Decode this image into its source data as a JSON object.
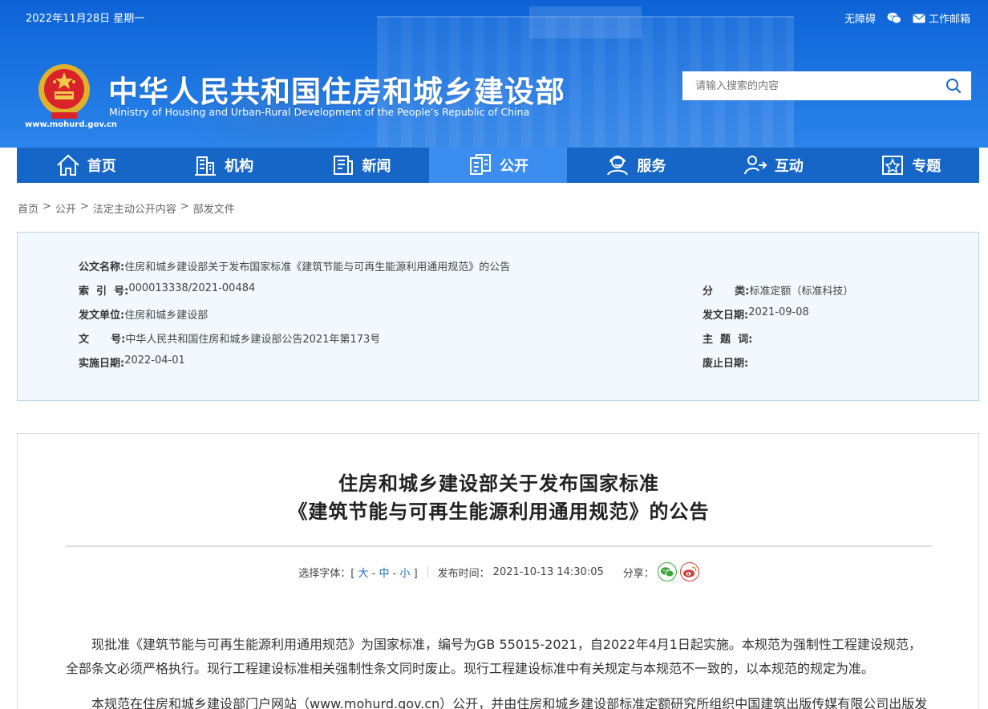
{
  "header": {
    "date": "2022年11月28日 星期一",
    "links": {
      "accessibility": "无障碍",
      "mail": "工作邮箱"
    },
    "site_url": "www.mohurd.gov.cn",
    "title": "中华人民共和国住房和城乡建设部",
    "subtitle": "Ministry of Housing and Urban-Rural Development of the People’s Republic of China",
    "search_placeholder": "请输入搜索的内容"
  },
  "nav": {
    "items": [
      {
        "label": "首页",
        "icon": "home-icon"
      },
      {
        "label": "机构",
        "icon": "building-icon"
      },
      {
        "label": "新闻",
        "icon": "news-icon"
      },
      {
        "label": "公开",
        "icon": "public-icon",
        "active": true
      },
      {
        "label": "服务",
        "icon": "service-icon"
      },
      {
        "label": "互动",
        "icon": "interaction-icon"
      },
      {
        "label": "专题",
        "icon": "topic-icon"
      }
    ]
  },
  "breadcrumb": {
    "items": [
      "首页",
      "公开",
      "法定主动公开内容",
      "部发文件"
    ],
    "separator": ">"
  },
  "info": {
    "doc_name_label": "公文名称:",
    "doc_name": "住房和城乡建设部关于发布国家标准《建筑节能与可再生能源利用通用规范》的公告",
    "index_label": "索  引  号:",
    "index": "000013338/2021-00484",
    "category_label": "分      类:",
    "category": "标准定额（标准科技）",
    "issuer_label": "发文单位:",
    "issuer": "住房和城乡建设部",
    "issue_date_label": "发文日期:",
    "issue_date": "2021-09-08",
    "doc_no_label": "文      号:",
    "doc_no": "中华人民共和国住房和城乡建设部公告2021年第173号",
    "subject_label": "主  题  词:",
    "subject": "",
    "effective_label": "实施日期:",
    "effective": "2022-04-01",
    "abolish_label": "废止日期:",
    "abolish": ""
  },
  "article": {
    "title_line1": "住房和城乡建设部关于发布国家标准",
    "title_line2": "《建筑节能与可再生能源利用通用规范》的公告",
    "font_size_label": "选择字体：[",
    "font_large": "大",
    "font_medium": "中",
    "font_small": "小",
    "font_close": "]",
    "publish_label": "发布时间：",
    "publish_time": "2021-10-13 14:30:05",
    "share_label": "分享：",
    "para1": "现批准《建筑节能与可再生能源利用通用规范》为国家标准，编号为GB 55015-2021，自2022年4月1日起实施。本规范为强制性工程建设规范，全部条文必须严格执行。现行工程建设标准相关强制性条文同时废止。现行工程建设标准中有关规定与本规范不一致的，以本规范的规定为准。",
    "para2": "本规范在住房和城乡建设部门户网站（www.mohurd.gov.cn）公开，并由住房和城乡建设部标准定额研究所组织中国建筑出版传媒有限公司出版发"
  }
}
